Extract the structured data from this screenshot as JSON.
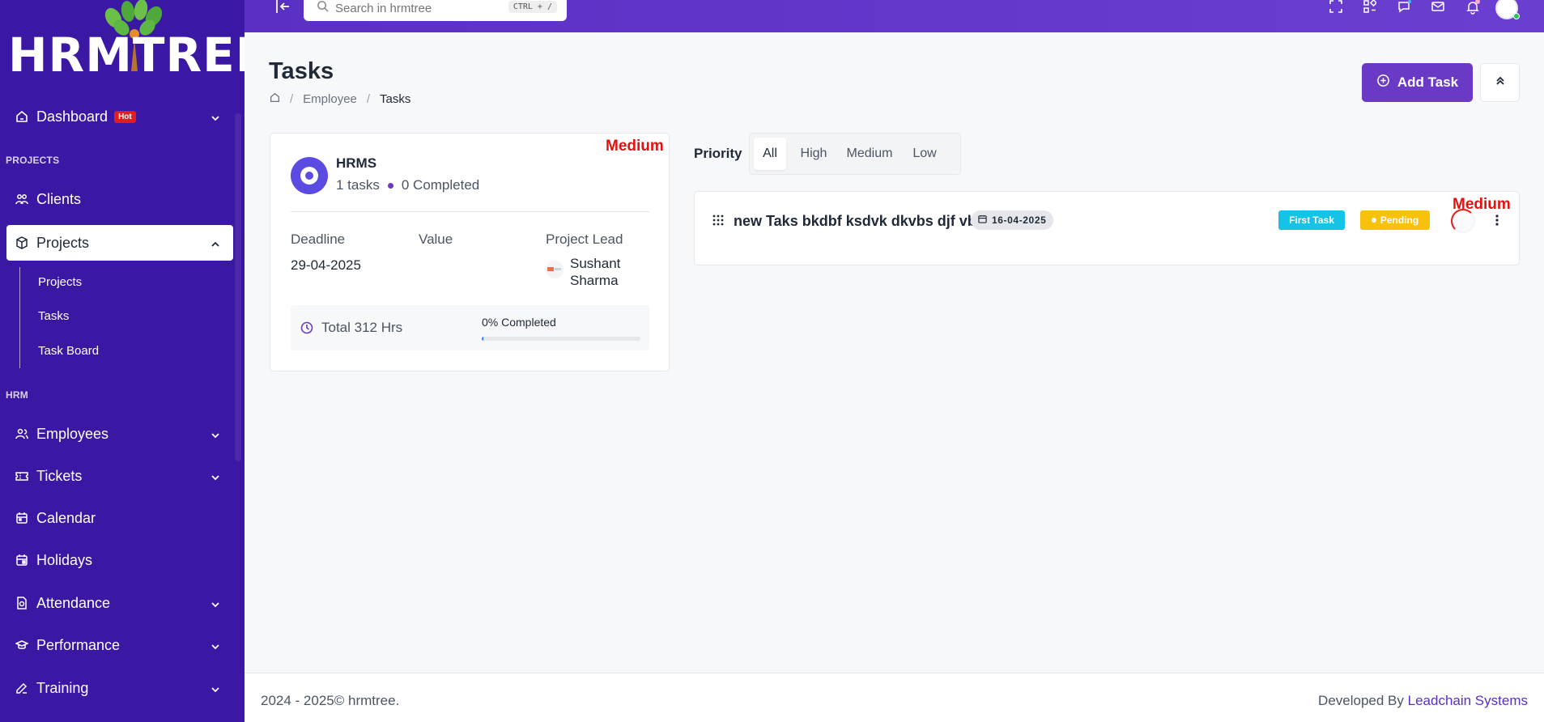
{
  "brand": {
    "logo_text": "HRMTREE"
  },
  "search": {
    "placeholder": "Search in hrmtree",
    "shortcut": "CTRL + /"
  },
  "sidebar": {
    "dashboard": {
      "label": "Dashboard",
      "badge": "Hot"
    },
    "section_projects": "PROJECTS",
    "clients": "Clients",
    "projects": "Projects",
    "sub_items": [
      "Projects",
      "Tasks",
      "Task Board"
    ],
    "section_hrm": "HRM",
    "employees": "Employees",
    "tickets": "Tickets",
    "calendar": "Calendar",
    "holidays": "Holidays",
    "attendance": "Attendance",
    "performance": "Performance",
    "training": "Training"
  },
  "page": {
    "title": "Tasks",
    "breadcrumb": [
      "Employee",
      "Tasks"
    ],
    "add_button": "Add Task"
  },
  "project_card": {
    "priority_tag": "Medium",
    "name": "HRMS",
    "tasks_text": "1 tasks",
    "completed_text": "0 Completed",
    "deadline_label": "Deadline",
    "deadline_value": "29-04-2025",
    "value_label": "Value",
    "lead_label": "Project Lead",
    "lead_name": "Sushant Sharma",
    "total_hours": "Total 312 Hrs",
    "progress_label": "0% Completed",
    "progress_fraction": 0
  },
  "priority_filter": {
    "label": "Priority",
    "options": [
      "All",
      "High",
      "Medium",
      "Low"
    ],
    "selected": "All"
  },
  "task": {
    "title": "new Taks bkdbf ksdvk dkvbs djf vbk",
    "date": "16-04-2025",
    "tag": "First Task",
    "status": "Pending",
    "priority_tag": "Medium"
  },
  "footer": {
    "copyright": "2024 - 2025© hrmtree.",
    "developed_by": "Developed By",
    "company": "Leadchain Systems"
  },
  "colors": {
    "sidebar": "#3b18a3",
    "accent": "#6a3ac6",
    "priority_red": "#e11212",
    "tag_cyan": "#14c3e6",
    "tag_yellow": "#f8c10c"
  }
}
